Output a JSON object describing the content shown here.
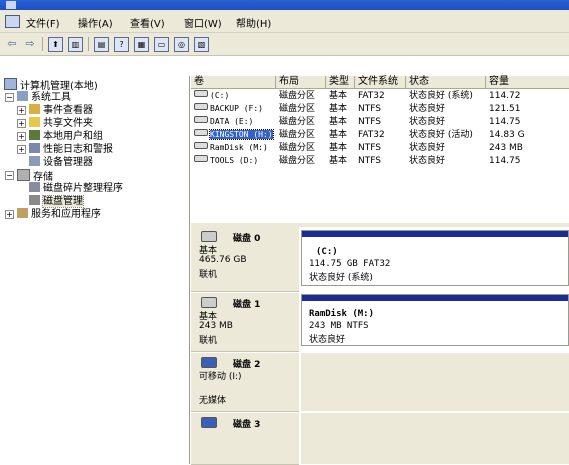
{
  "menu": {
    "file": "文件(F)",
    "action": "操作(A)",
    "view": "查看(V)",
    "window": "窗口(W)",
    "help": "帮助(H)"
  },
  "tree": {
    "root": "计算机管理(本地)",
    "system_tools": "系统工具",
    "event_viewer": "事件查看器",
    "shared_folders": "共享文件夹",
    "local_users": "本地用户和组",
    "perf_logs": "性能日志和警报",
    "device_manager": "设备管理器",
    "storage": "存储",
    "defrag": "磁盘碎片整理程序",
    "disk_mgmt": "磁盘管理",
    "services": "服务和应用程序"
  },
  "columns": [
    "卷",
    "布局",
    "类型",
    "文件系统",
    "状态",
    "容量"
  ],
  "volumes": [
    {
      "name": "(C:)",
      "layout": "磁盘分区",
      "type": "基本",
      "fs": "FAT32",
      "status": "状态良好 (系统)",
      "cap": "114.72"
    },
    {
      "name": "BACKUP (F:)",
      "layout": "磁盘分区",
      "type": "基本",
      "fs": "NTFS",
      "status": "状态良好",
      "cap": "121.51"
    },
    {
      "name": "DATA (E:)",
      "layout": "磁盘分区",
      "type": "基本",
      "fs": "NTFS",
      "status": "状态良好",
      "cap": "114.75"
    },
    {
      "name": "KINGSTON (H:)",
      "layout": "磁盘分区",
      "type": "基本",
      "fs": "FAT32",
      "status": "状态良好 (活动)",
      "cap": "14.83 G"
    },
    {
      "name": "RamDisk (M:)",
      "layout": "磁盘分区",
      "type": "基本",
      "fs": "NTFS",
      "status": "状态良好",
      "cap": "243 MB"
    },
    {
      "name": "TOOLS (D:)",
      "layout": "磁盘分区",
      "type": "基本",
      "fs": "NTFS",
      "status": "状态良好",
      "cap": "114.75"
    }
  ],
  "disks": {
    "d0": {
      "name": "磁盘 0",
      "type": "基本",
      "size": "465.76 GB",
      "state": "联机",
      "part_name": "(C:)",
      "part_info": "114.75 GB FAT32",
      "part_status": "状态良好 (系统)"
    },
    "d1": {
      "name": "磁盘 1",
      "type": "基本",
      "size": "243 MB",
      "state": "联机",
      "part_name": "RamDisk  (M:)",
      "part_info": "243 MB NTFS",
      "part_status": "状态良好"
    },
    "d2": {
      "name": "磁盘 2",
      "type": "可移动 (I:)",
      "state": "无媒体"
    },
    "d3": {
      "name": "磁盘 3"
    }
  }
}
